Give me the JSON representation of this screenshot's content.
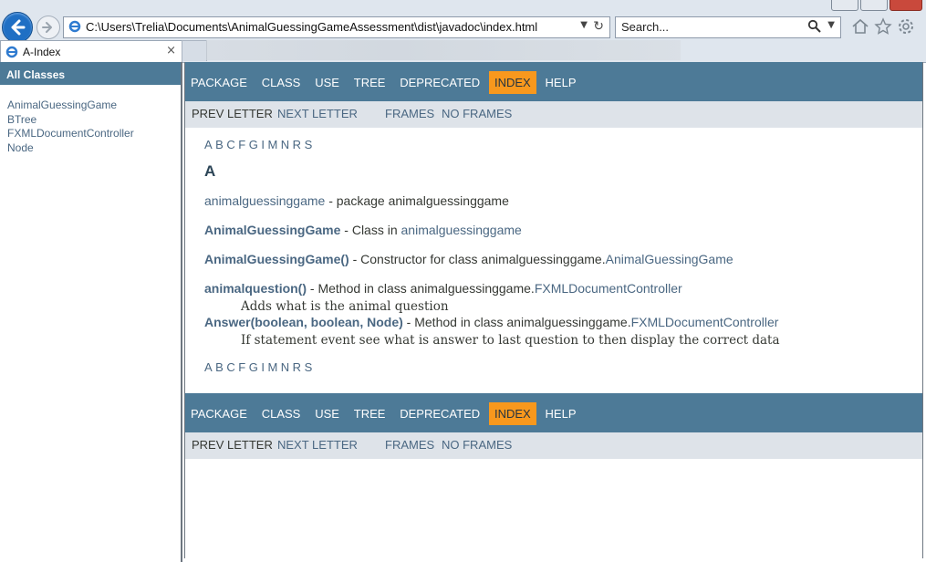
{
  "browser": {
    "url": "C:\\Users\\Trelia\\Documents\\AnimalGuessingGameAssessment\\dist\\javadoc\\index.html",
    "search_placeholder": "Search...",
    "tab_title": "A-Index",
    "tab_close": "×"
  },
  "left_frame": {
    "header": "All Classes",
    "classes": [
      "AnimalGuessingGame",
      "BTree",
      "FXMLDocumentController",
      "Node"
    ]
  },
  "nav": {
    "items": [
      "PACKAGE",
      "CLASS",
      "USE",
      "TREE",
      "DEPRECATED",
      "INDEX",
      "HELP"
    ],
    "active": "INDEX",
    "prev_letter": "PREV LETTER",
    "next_letter": "NEXT LETTER",
    "frames": "FRAMES",
    "no_frames": "NO FRAMES"
  },
  "index": {
    "letters": [
      "A",
      "B",
      "C",
      "F",
      "G",
      "I",
      "M",
      "N",
      "R",
      "S"
    ],
    "heading": "A",
    "entries": [
      {
        "name": "animalguessinggame",
        "text": " - package animalguessinggame",
        "link": ""
      },
      {
        "name": "AnimalGuessingGame",
        "text": " - Class in ",
        "link": "animalguessinggame"
      },
      {
        "name": "AnimalGuessingGame()",
        "text": " - Constructor for class animalguessinggame.",
        "link": "AnimalGuessingGame"
      },
      {
        "name": "animalquestion()",
        "text": " - Method in class animalguessinggame.",
        "link": "FXMLDocumentController",
        "desc": "Adds what is the animal question"
      },
      {
        "name": "Answer(boolean, boolean, Node)",
        "text": " - Method in class animalguessinggame.",
        "link": "FXMLDocumentController",
        "desc": "If statement event see what is answer to last question to then display the correct data"
      }
    ]
  }
}
